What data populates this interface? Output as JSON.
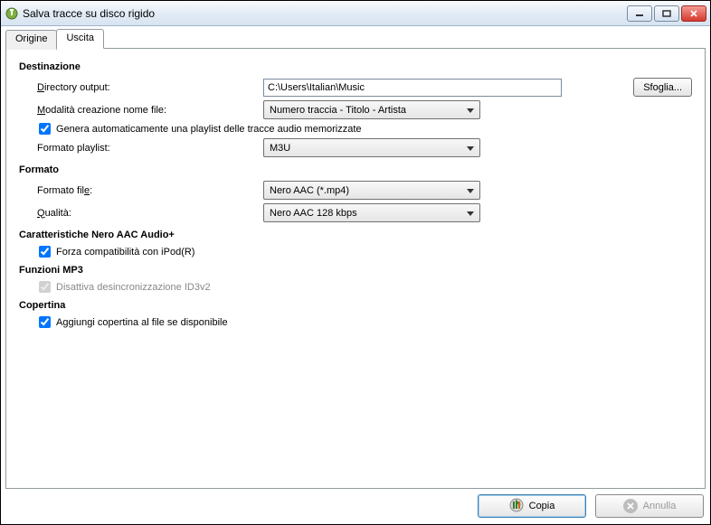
{
  "window": {
    "title": "Salva tracce su disco rigido"
  },
  "tabs": {
    "origine": "Origine",
    "uscita": "Uscita"
  },
  "sections": {
    "destinazione": "Destinazione",
    "formato": "Formato",
    "neroaac": "Caratteristiche Nero AAC Audio+",
    "mp3": "Funzioni MP3",
    "copertina": "Copertina"
  },
  "labels": {
    "directory_output": "Directory output:",
    "filename_mode": "Modalità creazione nome file:",
    "gen_playlist": "Genera automaticamente una playlist delle tracce audio memorizzate",
    "playlist_format": "Formato playlist:",
    "file_format": "Formato file:",
    "quality": "Qualità:",
    "ipod_compat": "Forza compatibilità con iPod(R)",
    "id3v2_desync": "Disattiva desincronizzazione ID3v2",
    "add_cover": "Aggiungi copertina al file se disponibile",
    "browse": "Sfoglia...",
    "copia": "Copia",
    "annulla": "Annulla"
  },
  "values": {
    "directory": "C:\\Users\\Italian\\Music",
    "filename_mode": "Numero traccia - Titolo - Artista",
    "playlist_format": "M3U",
    "file_format": "Nero AAC (*.mp4)",
    "quality": "Nero AAC 128 kbps",
    "gen_playlist_checked": true,
    "ipod_compat_checked": true,
    "id3v2_desync_checked": true,
    "add_cover_checked": true
  },
  "underline": {
    "directory": "D",
    "filename_mode": "M",
    "gen_playlist": "G",
    "quality": "Q",
    "ipod_compat": "F",
    "id3v2_desync": "I",
    "add_cover": "A",
    "browse": "S",
    "annulla": "A"
  }
}
